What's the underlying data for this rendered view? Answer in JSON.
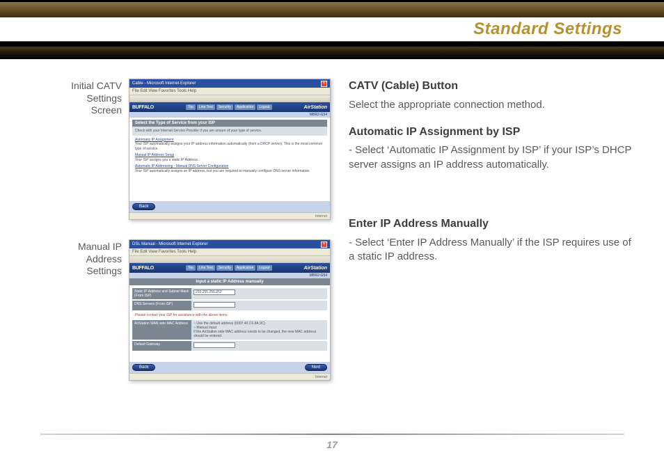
{
  "header": {
    "title": "Standard Settings"
  },
  "figures": [
    {
      "caption_lines": [
        "Initial CATV",
        "Settings",
        "Screen"
      ],
      "browser_title": "Cable - Microsoft Internet Explorer",
      "menu": "File  Edit  View  Favorites  Tools  Help",
      "brand": "BUFFALO",
      "nav": [
        "Top",
        "Line Test",
        "Security",
        "Application",
        "Logout"
      ],
      "air": "AirStation",
      "model": "WBR2-G54",
      "grayheader": "Select the Type of Service from your ISP",
      "note": "Check with your Internet Service Provider if you are unsure of your type of service.",
      "opts": [
        {
          "t": "Automatic IP Assignment",
          "d": "Your ISP automatically assigns your IP address information automatically (from a DHCP server). This is the most common type of service."
        },
        {
          "t": "Manual IP Address Setup",
          "d": "Your ISP assigns you a static IP Address."
        },
        {
          "t": "Automatic IP Addressing - Manual DNS Server Configuration",
          "d": "Your ISP automatically assigns an IP address, but you are required to manually configure DNS server information."
        }
      ],
      "back": "Back",
      "status": "Internet"
    },
    {
      "caption_lines": [
        "Manual IP",
        "Address",
        "Settings"
      ],
      "browser_title": "DSL Manual - Microsoft Internet Explorer",
      "menu": "File  Edit  View  Favorites  Tools  Help",
      "brand": "BUFFALO",
      "nav": [
        "Top",
        "Line Test",
        "Security",
        "Application",
        "Logout"
      ],
      "air": "AirStation",
      "model": "WBR2-G54",
      "grayheader": "Input a static IP Address manually",
      "rows": [
        {
          "lbl": "Static IP Address and Subnet Mask (From ISP)",
          "val": "255.255.255.252"
        },
        {
          "lbl": "DNS Servers (From ISP)",
          "val": ""
        }
      ],
      "hint": "Please contact your ISP for assistance with the above items.",
      "macrow_lbl": "AirStation WAN side MAC Address",
      "mac_opts": [
        "Use the default address (0007.40.C6.8A.9C)",
        "Manual input"
      ],
      "mac_note": "If the AirStation side MAC address needs to be changed, the new MAC address should be entered.",
      "gateway_lbl": "Default Gateway",
      "back": "Back",
      "next": "Next",
      "status": "Internet"
    }
  ],
  "right": {
    "s1_title": "CATV (Cable) Button",
    "s1_body": "Select the appropriate connection method.",
    "s2_title": "Automatic IP Assignment by ISP",
    "s2_body": "- Select ‘Automatic IP Assignment by ISP’  if your ISP’s DHCP server assigns an IP address automatically.",
    "s3_title": "Enter IP Address Manually",
    "s3_body": "- Select ‘Enter IP Address Manually’ if the ISP requires use of a static IP address."
  },
  "page_number": "17"
}
